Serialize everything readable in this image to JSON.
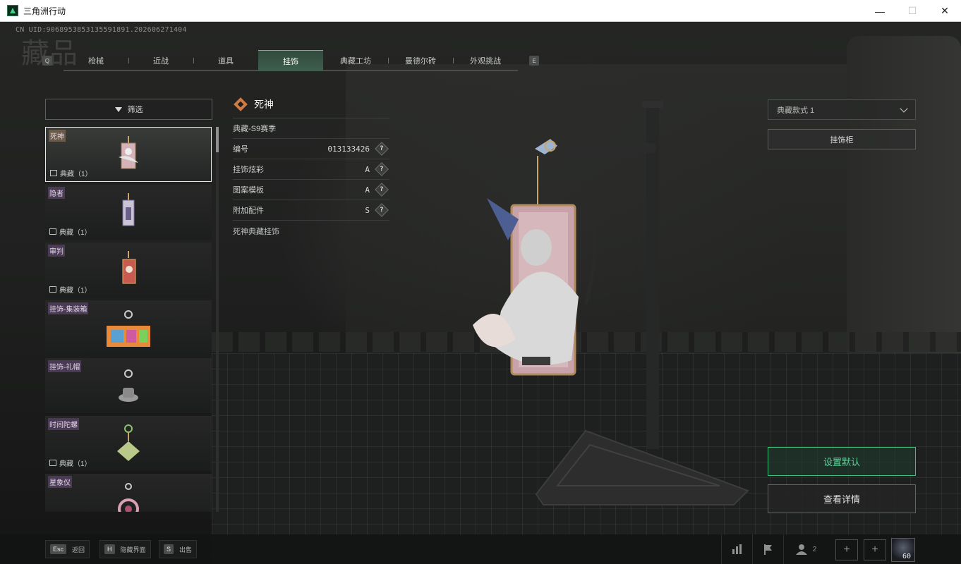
{
  "window": {
    "title": "三角洲行动",
    "controls": [
      "—",
      "☐",
      "✕"
    ]
  },
  "header": {
    "uid": "CN UID:9068953853135591891.202606271404",
    "big_title": "藏品",
    "left_key": "Q",
    "right_key": "E"
  },
  "tabs": [
    {
      "label": "枪械",
      "active": false
    },
    {
      "label": "近战",
      "active": false
    },
    {
      "label": "道具",
      "active": false
    },
    {
      "label": "挂饰",
      "active": true
    },
    {
      "label": "典藏工坊",
      "active": false
    },
    {
      "label": "曼德尔砖",
      "active": false
    },
    {
      "label": "外观挑战",
      "active": false
    }
  ],
  "filter": {
    "label": "筛选"
  },
  "items": [
    {
      "name": "死神",
      "tag": "典藏（1）",
      "selected": true
    },
    {
      "name": "隐者",
      "tag": "典藏（1）",
      "selected": false
    },
    {
      "name": "审判",
      "tag": "典藏（1）",
      "selected": false
    },
    {
      "name": "挂饰-集装箱",
      "tag": "",
      "selected": false
    },
    {
      "name": "挂饰-礼帽",
      "tag": "",
      "selected": false
    },
    {
      "name": "时间陀螺",
      "tag": "典藏（1）",
      "selected": false
    },
    {
      "name": "星象仪",
      "tag": "",
      "selected": false
    }
  ],
  "detail": {
    "title": "死神",
    "season": "典藏-S9赛季",
    "rows": [
      {
        "label": "编号",
        "value": "013133426"
      },
      {
        "label": "挂饰炫彩",
        "value": "A"
      },
      {
        "label": "图案模板",
        "value": "A"
      },
      {
        "label": "附加配件",
        "value": "S"
      }
    ],
    "help_glyph": "?",
    "note": "死神典藏挂饰"
  },
  "right": {
    "style_select": "典藏款式 1",
    "cabinet": "挂饰柜",
    "set_default": "设置默认",
    "view_details": "查看详情"
  },
  "bottom": {
    "hints": [
      {
        "key": "Esc",
        "label": "返回"
      },
      {
        "key": "H",
        "label": "隐藏界面"
      },
      {
        "key": "S",
        "label": "出售"
      }
    ],
    "friends_count": "2",
    "level": "60"
  },
  "colors": {
    "accent_green": "#3fbf7a",
    "active_tab_bg": "#3f5f4e",
    "rarity_orange": "#d07a45",
    "item_name_purple": "#4b3a55"
  },
  "icons": [
    "filter-icon",
    "rarity-diamond-icon",
    "help-icon",
    "chevron-down-icon",
    "stats-icon",
    "flag-icon",
    "friends-icon",
    "plus-icon"
  ]
}
